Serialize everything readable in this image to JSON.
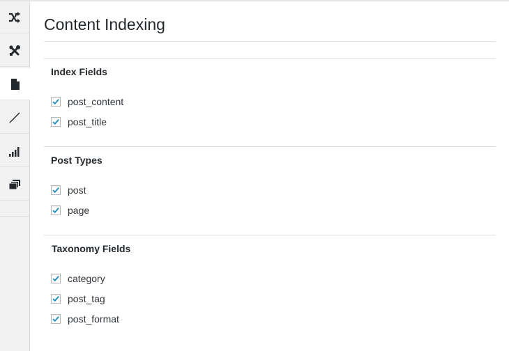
{
  "page": {
    "title": "Content Indexing"
  },
  "sidebar": {
    "items": [
      {
        "icon": "shuffle-icon"
      },
      {
        "icon": "tools-icon"
      },
      {
        "icon": "page-icon",
        "active": true
      },
      {
        "icon": "line-icon"
      },
      {
        "icon": "signal-bars-icon"
      },
      {
        "icon": "stacked-windows-icon"
      }
    ]
  },
  "sections": [
    {
      "heading": "Index Fields",
      "options": [
        {
          "label": "post_content",
          "checked": true
        },
        {
          "label": "post_title",
          "checked": true
        }
      ]
    },
    {
      "heading": "Post Types",
      "options": [
        {
          "label": "post",
          "checked": true
        },
        {
          "label": "page",
          "checked": true
        }
      ]
    },
    {
      "heading": "Taxonomy Fields",
      "options": [
        {
          "label": "category",
          "checked": true
        },
        {
          "label": "post_tag",
          "checked": true
        },
        {
          "label": "post_format",
          "checked": true
        }
      ]
    }
  ],
  "colors": {
    "checkmark": "#1e8cbe",
    "sidebar_bg": "#f1f1f1",
    "text": "#23282d"
  }
}
